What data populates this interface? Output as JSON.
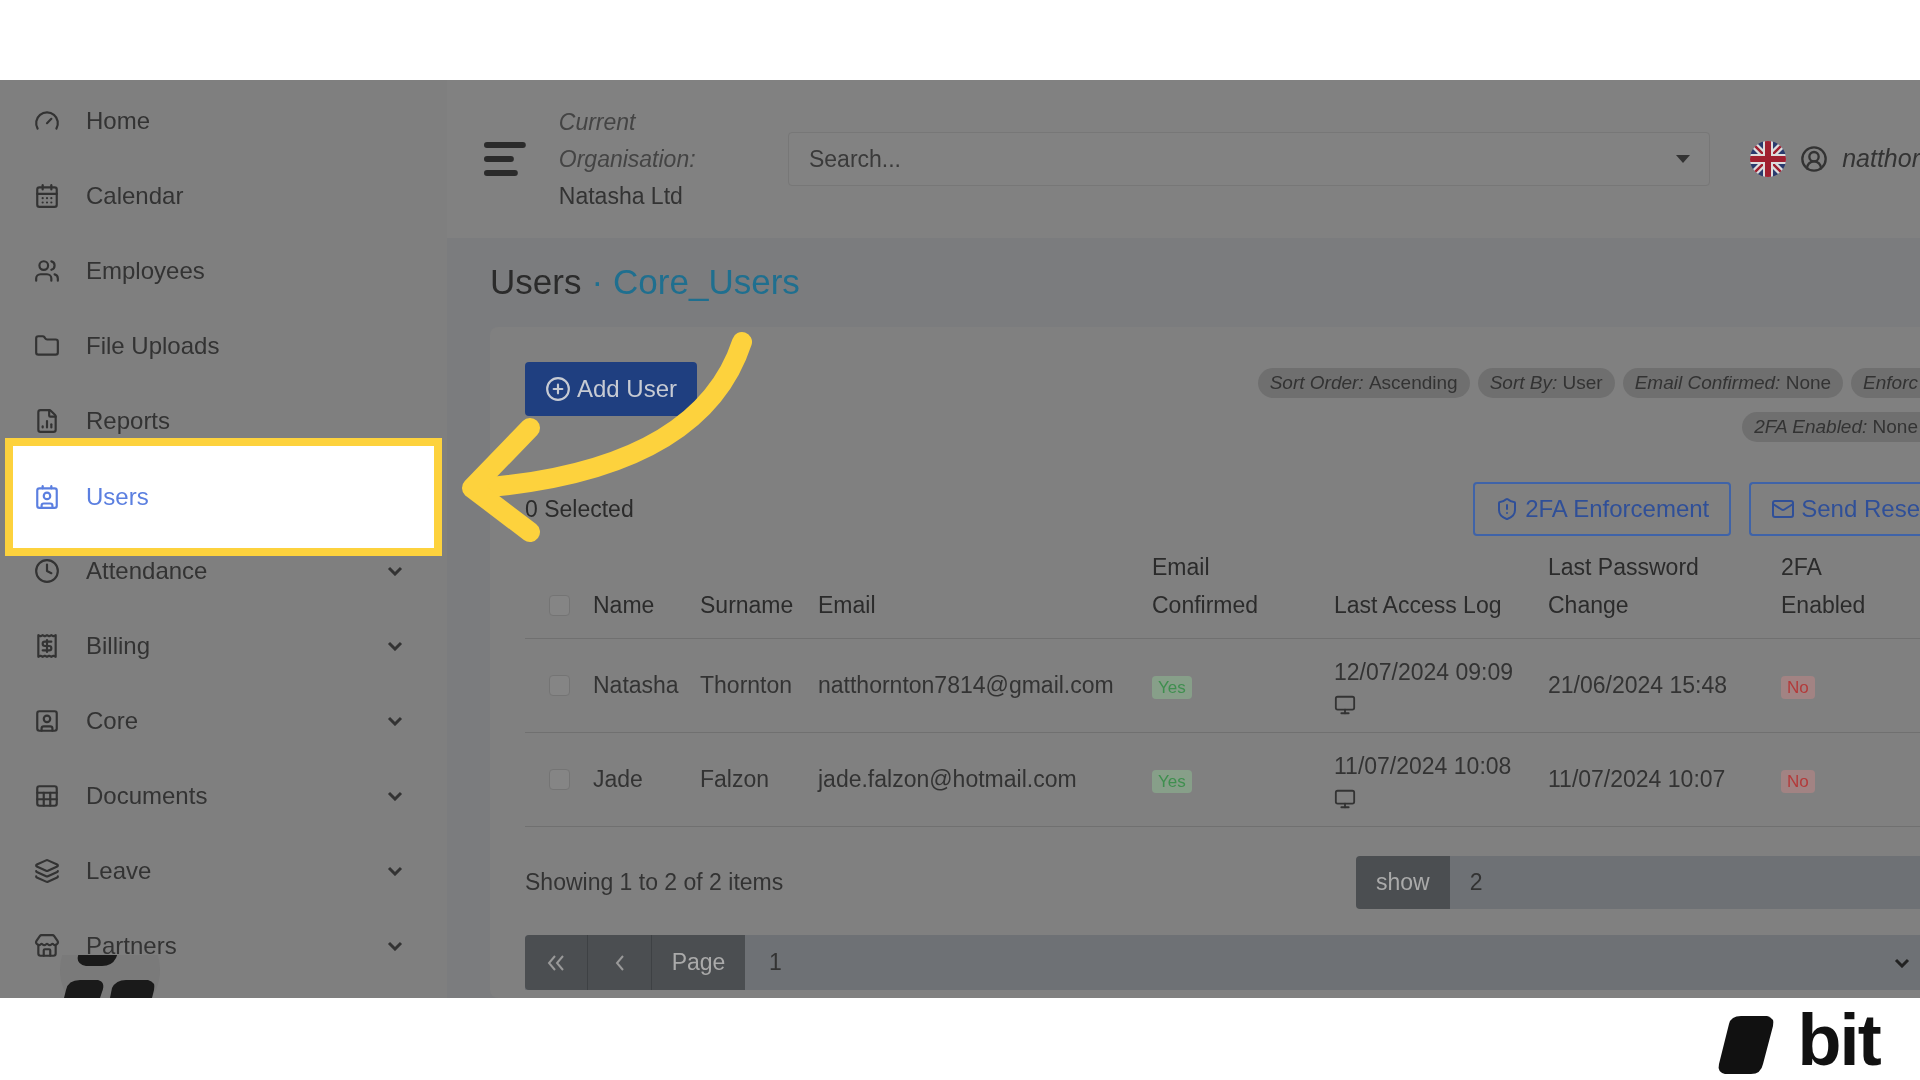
{
  "sidebar": {
    "items": [
      {
        "label": "Home",
        "expandable": false,
        "selected": false
      },
      {
        "label": "Calendar",
        "expandable": false,
        "selected": false
      },
      {
        "label": "Employees",
        "expandable": false,
        "selected": false
      },
      {
        "label": "File Uploads",
        "expandable": false,
        "selected": false
      },
      {
        "label": "Reports",
        "expandable": false,
        "selected": false
      },
      {
        "label": "Users",
        "expandable": false,
        "selected": true
      },
      {
        "label": "Attendance",
        "expandable": true,
        "selected": false
      },
      {
        "label": "Billing",
        "expandable": true,
        "selected": false
      },
      {
        "label": "Core",
        "expandable": true,
        "selected": false
      },
      {
        "label": "Documents",
        "expandable": true,
        "selected": false
      },
      {
        "label": "Leave",
        "expandable": true,
        "selected": false
      },
      {
        "label": "Partners",
        "expandable": true,
        "selected": false
      }
    ]
  },
  "header": {
    "organisation_label": "Current Organisation:",
    "organisation": "Natasha Ltd",
    "search": {
      "placeholder": "Search..."
    },
    "user": "natthor"
  },
  "breadcrumb": {
    "items": [
      "Users",
      "Core_Users"
    ],
    "separator": "·"
  },
  "add_button": "Add User",
  "filters": [
    {
      "key": "Sort Order:",
      "value": "Ascending"
    },
    {
      "key": "Sort By:",
      "value": "User"
    },
    {
      "key": "Email Confirmed:",
      "value": "None"
    },
    {
      "key": "Enforc"
    }
  ],
  "filters_row_2": [
    {
      "key": "2FA Enabled:",
      "value": "None"
    }
  ],
  "selected_count": "0 Selected",
  "actions": [
    {
      "label": "2FA Enforcement",
      "kind": "shield"
    },
    {
      "label": "Send Rese",
      "kind": "mail"
    }
  ],
  "table": {
    "select_all": {
      "checked": false
    },
    "columns": [
      "Name",
      "Surname",
      "Email",
      "Email Confirmed",
      "Last Access Log",
      "Last Password Change",
      "2FA Enabled"
    ],
    "rows": [
      {
        "checked": false,
        "name": "Natasha",
        "surname": "Thornton",
        "email": "natthornton7814@gmail.com",
        "email_confirmed": {
          "text": "Yes",
          "kind": "positive"
        },
        "last_access": "12/07/2024 09:09",
        "last_password_change": "21/06/2024 15:48",
        "two_fa": {
          "text": "No",
          "kind": "negative"
        }
      },
      {
        "checked": false,
        "name": "Jade",
        "surname": "Falzon",
        "email": "jade.falzon@hotmail.com",
        "email_confirmed": {
          "text": "Yes",
          "kind": "positive"
        },
        "last_access": "11/07/2024 10:08",
        "last_password_change": "11/07/2024 10:07",
        "two_fa": {
          "text": "No",
          "kind": "negative"
        }
      }
    ]
  },
  "summary": "Showing 1 to 2 of 2 items",
  "page_size": {
    "label": "show",
    "value": "2"
  },
  "pagination": {
    "page_label": "Page",
    "page": "1"
  },
  "brand": "bit"
}
